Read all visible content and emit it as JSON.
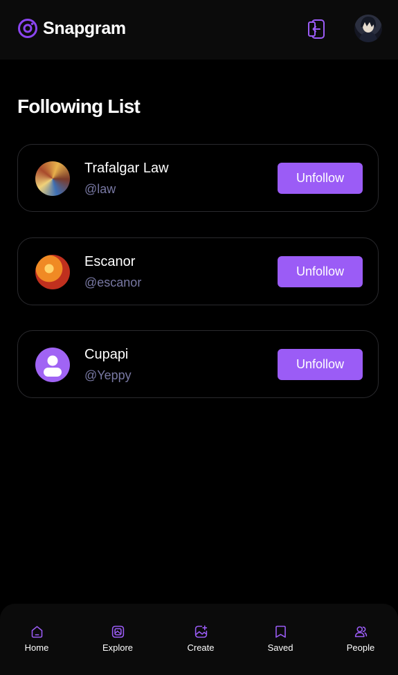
{
  "app": {
    "name": "Snapgram",
    "accent_color": "#9b5cf6"
  },
  "header": {
    "logout_icon": "logout-icon",
    "avatar_icon": "user-avatar"
  },
  "page": {
    "title": "Following List"
  },
  "following": [
    {
      "name": "Trafalgar Law",
      "handle": "@law",
      "button_label": "Unfollow"
    },
    {
      "name": "Escanor",
      "handle": "@escanor",
      "button_label": "Unfollow"
    },
    {
      "name": "Cupapi",
      "handle": "@Yeppy",
      "button_label": "Unfollow"
    }
  ],
  "bottom_nav": [
    {
      "label": "Home",
      "icon": "home-icon"
    },
    {
      "label": "Explore",
      "icon": "explore-icon"
    },
    {
      "label": "Create",
      "icon": "create-icon"
    },
    {
      "label": "Saved",
      "icon": "saved-icon"
    },
    {
      "label": "People",
      "icon": "people-icon"
    }
  ]
}
